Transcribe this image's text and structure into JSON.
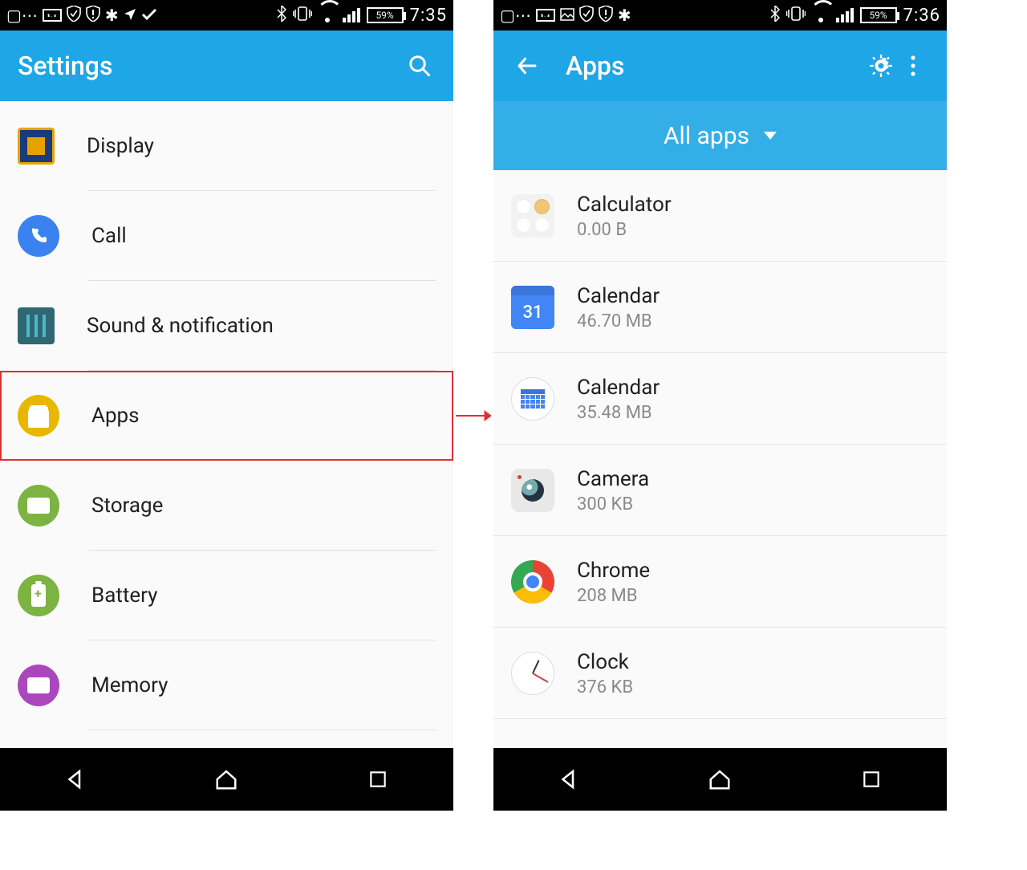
{
  "left": {
    "statusbar": {
      "battery": "59%",
      "time": "7:35"
    },
    "appbar": {
      "title": "Settings"
    },
    "items": [
      {
        "label": "Display"
      },
      {
        "label": "Call"
      },
      {
        "label": "Sound & notification"
      },
      {
        "label": "Apps"
      },
      {
        "label": "Storage"
      },
      {
        "label": "Battery"
      },
      {
        "label": "Memory"
      }
    ]
  },
  "right": {
    "statusbar": {
      "battery": "59%",
      "time": "7:36"
    },
    "appbar": {
      "title": "Apps"
    },
    "filter": "All apps",
    "apps": [
      {
        "name": "Calculator",
        "size": "0.00 B"
      },
      {
        "name": "Calendar",
        "size": "46.70 MB"
      },
      {
        "name": "Calendar",
        "size": "35.48 MB"
      },
      {
        "name": "Camera",
        "size": "300 KB"
      },
      {
        "name": "Chrome",
        "size": "208 MB"
      },
      {
        "name": "Clock",
        "size": "376 KB"
      }
    ]
  }
}
